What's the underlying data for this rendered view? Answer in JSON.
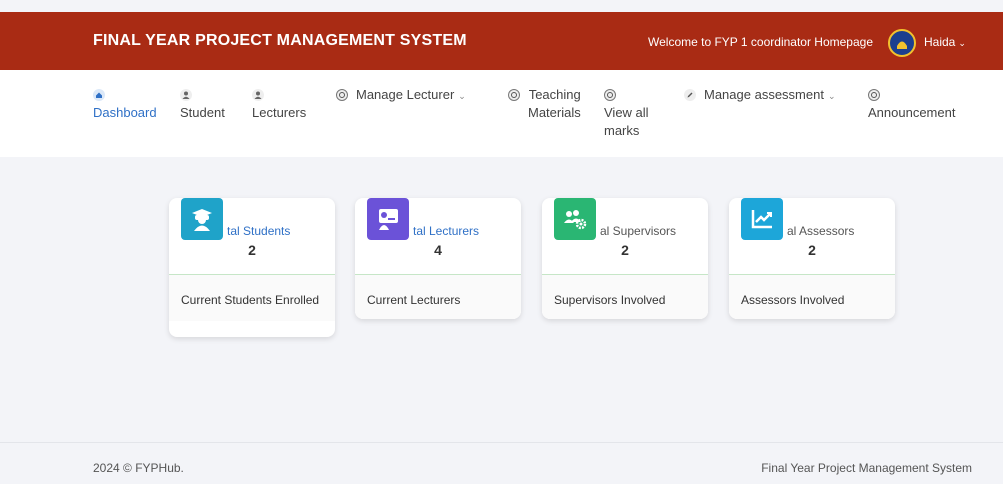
{
  "header": {
    "title": "FINAL YEAR PROJECT MANAGEMENT SYSTEM",
    "welcome": "Welcome to FYP 1 coordinator Homepage",
    "user_name": "Haida",
    "user_chevron": "⌄",
    "bg_color": "#a92b14"
  },
  "nav": {
    "dashboard": "Dashboard",
    "student": "Student",
    "lecturers": "Lecturers",
    "manage_lecturer": "Manage Lecturer",
    "teaching_1": "Teaching",
    "teaching_2": "Materials",
    "marks_1": "View all",
    "marks_2": "marks",
    "manage_assessment": "Manage assessment",
    "announcement": "Announcement",
    "chevron": "⌄",
    "active_color": "#2f70c6"
  },
  "cards": [
    {
      "title": "tal Students",
      "count": "2",
      "footer": "Current Students Enrolled",
      "icon": "graduate-icon",
      "color": "#1fa3c9"
    },
    {
      "title": "tal Lecturers",
      "count": "4",
      "footer": "Current Lecturers",
      "icon": "presentation-icon",
      "color": "#6b52d8"
    },
    {
      "title": "al Supervisors",
      "count": "2",
      "footer": "Supervisors Involved",
      "icon": "users-gear-icon",
      "color": "#2ab673"
    },
    {
      "title": "al Assessors",
      "count": "2",
      "footer": "Assessors Involved",
      "icon": "chart-line-icon",
      "color": "#1da6d9"
    }
  ],
  "footer": {
    "left": "2024 © FYPHub.",
    "right": "Final Year Project Management System"
  }
}
